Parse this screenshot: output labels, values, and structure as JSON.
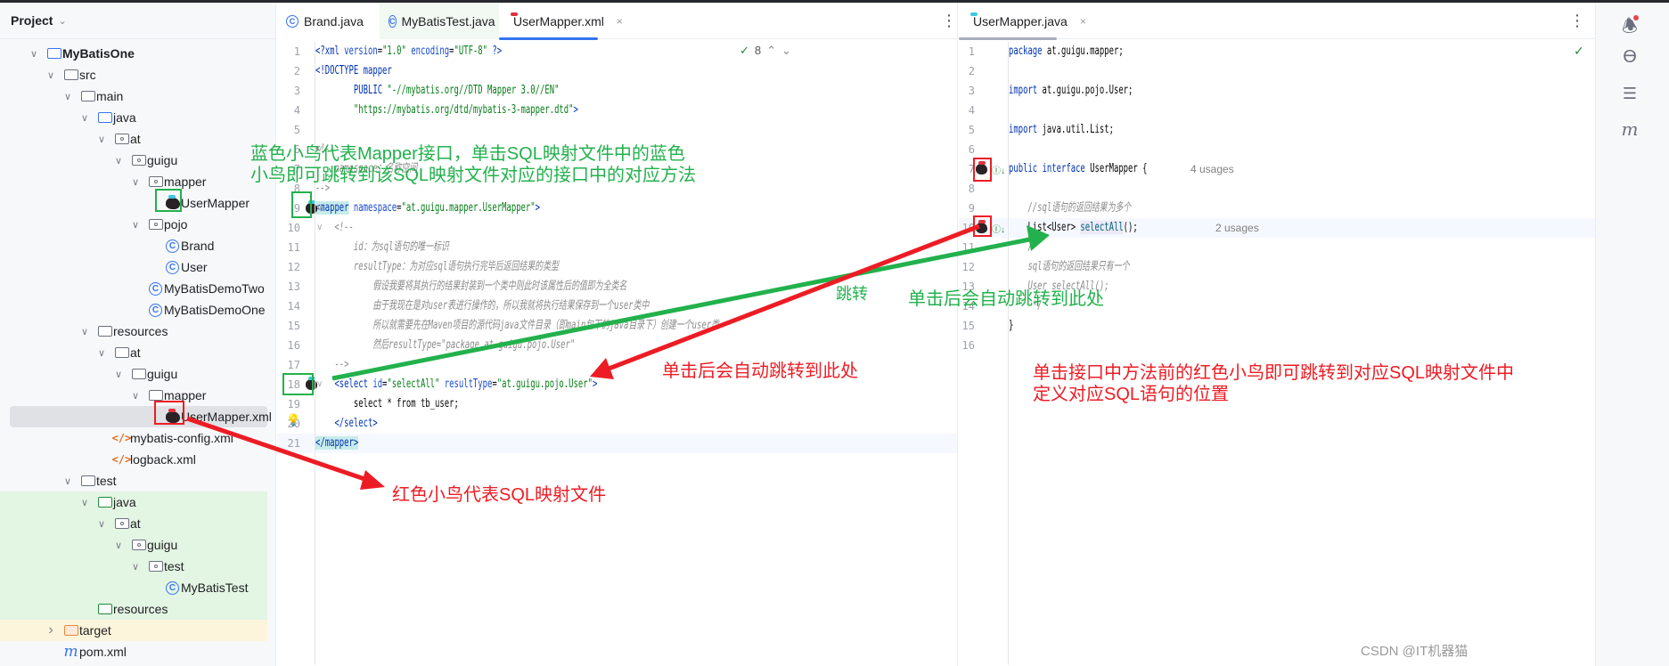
{
  "project_panel": {
    "title": "Project",
    "tree": [
      {
        "label": "MyBatisOne",
        "depth": 0,
        "icon": "module-folder",
        "expanded": true,
        "bold": true
      },
      {
        "label": "src",
        "depth": 1,
        "icon": "folder",
        "expanded": true
      },
      {
        "label": "main",
        "depth": 2,
        "icon": "folder",
        "expanded": true
      },
      {
        "label": "java",
        "depth": 3,
        "icon": "source-folder",
        "expanded": true
      },
      {
        "label": "at",
        "depth": 4,
        "icon": "package",
        "expanded": true
      },
      {
        "label": "guigu",
        "depth": 5,
        "icon": "package",
        "expanded": true
      },
      {
        "label": "mapper",
        "depth": 6,
        "icon": "package",
        "expanded": true
      },
      {
        "label": "UserMapper",
        "depth": 7,
        "icon": "mybatis-interface"
      },
      {
        "label": "pojo",
        "depth": 6,
        "icon": "package",
        "expanded": true
      },
      {
        "label": "Brand",
        "depth": 7,
        "icon": "class"
      },
      {
        "label": "User",
        "depth": 7,
        "icon": "class"
      },
      {
        "label": "MyBatisDemoTwo",
        "depth": 6,
        "icon": "runnable-class"
      },
      {
        "label": "MyBatisDemoOne",
        "depth": 6,
        "icon": "runnable-class"
      },
      {
        "label": "resources",
        "depth": 3,
        "icon": "resources-folder",
        "expanded": true
      },
      {
        "label": "at",
        "depth": 4,
        "icon": "folder",
        "expanded": true
      },
      {
        "label": "guigu",
        "depth": 5,
        "icon": "folder",
        "expanded": true
      },
      {
        "label": "mapper",
        "depth": 6,
        "icon": "folder",
        "expanded": true
      },
      {
        "label": "UserMapper.xml",
        "depth": 7,
        "icon": "mybatis-xml",
        "selected": true
      },
      {
        "label": "mybatis-config.xml",
        "depth": 4,
        "icon": "xml"
      },
      {
        "label": "logback.xml",
        "depth": 4,
        "icon": "xml"
      },
      {
        "label": "test",
        "depth": 2,
        "icon": "folder",
        "expanded": true
      },
      {
        "label": "java",
        "depth": 3,
        "icon": "test-source-folder",
        "expanded": true,
        "bg": "#e3f5e3"
      },
      {
        "label": "at",
        "depth": 4,
        "icon": "package",
        "expanded": true,
        "bg": "#e3f5e3"
      },
      {
        "label": "guigu",
        "depth": 5,
        "icon": "package",
        "expanded": true,
        "bg": "#e3f5e3"
      },
      {
        "label": "test",
        "depth": 6,
        "icon": "package",
        "expanded": true,
        "bg": "#e3f5e3"
      },
      {
        "label": "MyBatisTest",
        "depth": 7,
        "icon": "class",
        "bg": "#e3f5e3"
      },
      {
        "label": "resources",
        "depth": 3,
        "icon": "test-resources-folder",
        "bg": "#e3f5e3"
      },
      {
        "label": "target",
        "depth": 1,
        "icon": "excluded-folder",
        "expanded": false,
        "bg": "#fdf4dc"
      },
      {
        "label": "pom.xml",
        "depth": 1,
        "icon": "maven"
      }
    ]
  },
  "left_editor": {
    "tabs": [
      {
        "label": "Brand.java",
        "icon": "class-icon"
      },
      {
        "label": "MyBatisTest.java",
        "icon": "class-icon"
      },
      {
        "label": "UserMapper.xml",
        "icon": "mybatis-xml-icon",
        "active": true,
        "close": "×"
      }
    ],
    "inspection_count": "8",
    "lines": [
      [
        [
          "<?xml ",
          "tag"
        ],
        [
          "version",
          "attr"
        ],
        [
          "=",
          "plain"
        ],
        [
          "\"1.0\"",
          "str"
        ],
        [
          " ",
          "plain"
        ],
        [
          "encoding",
          "attr"
        ],
        [
          "=",
          "plain"
        ],
        [
          "\"UTF-8\"",
          "str"
        ],
        [
          " ?>",
          "tag"
        ]
      ],
      [
        [
          "<!DOCTYPE mapper",
          "tag"
        ]
      ],
      [
        [
          "        PUBLIC ",
          "tag"
        ],
        [
          "\"-//mybatis.org//DTD Mapper 3.0//EN\"",
          "str"
        ]
      ],
      [
        [
          "        ",
          "plain"
        ],
        [
          "\"https://mybatis.org/dtd/mybatis-3-mapper.dtd\"",
          "str"
        ],
        [
          ">",
          "tag"
        ]
      ],
      [],
      [
        [
          "<!--",
          "cmt"
        ]
      ],
      [
        [
          "    namespace：名称空间",
          "cmt"
        ]
      ],
      [
        [
          "-->",
          "cmt"
        ]
      ],
      [
        [
          "<mapper",
          "tag tagbg"
        ],
        [
          " namespace",
          "attr"
        ],
        [
          "=",
          "plain"
        ],
        [
          "\"at.guigu.mapper.UserMapper\"",
          "str"
        ],
        [
          ">",
          "tag"
        ]
      ],
      [
        [
          "    <!--",
          "cmt"
        ]
      ],
      [
        [
          "        id：为sql语句的唯一标识",
          "cmt"
        ]
      ],
      [
        [
          "        resultType：为对应sql语句执行完毕后返回结果的类型",
          "cmt"
        ]
      ],
      [
        [
          "            假设我要将其执行的结果封装到一个类中则此时该属性后的值即为全类名",
          "cmt"
        ]
      ],
      [
        [
          "            由于我现在是对user表进行操作的，所以我就将执行结果保存到一个user类中",
          "cmt"
        ]
      ],
      [
        [
          "            所以就需要先在Maven项目的源代码java文件目录（即main包下的java目录下）创建一个user类",
          "cmt"
        ]
      ],
      [
        [
          "            然后resultType=\"package at.guigu.pojo.User\"",
          "cmt"
        ]
      ],
      [
        [
          "    -->",
          "cmt"
        ]
      ],
      [
        [
          "    <select",
          "tag"
        ],
        [
          " id",
          "attr"
        ],
        [
          "=",
          "plain"
        ],
        [
          "\"selectAll\"",
          "str"
        ],
        [
          " resultType",
          "attr"
        ],
        [
          "=",
          "plain"
        ],
        [
          "\"at.guigu.pojo.User\"",
          "str"
        ],
        [
          ">",
          "tag"
        ]
      ],
      [
        [
          "        select * from tb_user;",
          "plain"
        ]
      ],
      [
        [
          "    </select>",
          "tag"
        ]
      ],
      [
        [
          "</mapper>",
          "tag tagbg"
        ]
      ]
    ]
  },
  "right_editor": {
    "tabs": [
      {
        "label": "UserMapper.java",
        "icon": "mybatis-interface-icon",
        "active": true,
        "close": "×"
      }
    ],
    "lines": [
      [
        [
          "package",
          "kw"
        ],
        [
          " at.guigu.mapper;",
          "plain"
        ]
      ],
      [],
      [
        [
          "import",
          "kw"
        ],
        [
          " at.guigu.pojo.User;",
          "plain"
        ]
      ],
      [],
      [
        [
          "import",
          "kw"
        ],
        [
          " java.util.List;",
          "plain"
        ]
      ],
      [],
      [
        [
          "public interface",
          "kw"
        ],
        [
          " UserMapper {",
          "plain"
        ]
      ],
      [],
      [
        [
          "    //sql语句的返回结果为多个",
          "cmt"
        ]
      ],
      [
        [
          "    List<User> ",
          "plain"
        ],
        [
          "selectAll",
          "meth"
        ],
        [
          "();",
          "plain"
        ]
      ],
      [
        [
          "    /*",
          "cmt"
        ]
      ],
      [
        [
          "    sql语句的返回结果只有一个",
          "cmt"
        ]
      ],
      [
        [
          "    User selectAll();",
          "cmt"
        ]
      ],
      [
        [
          "     */",
          "cmt"
        ]
      ],
      [
        [
          "}",
          "plain"
        ]
      ],
      []
    ],
    "inlays": {
      "line7": "4 usages",
      "line10": "2 usages"
    }
  },
  "annotations": {
    "green_note_1": "蓝色小鸟代表Mapper接口，单击SQL映射文件中的蓝色",
    "green_note_2": "小鸟即可跳转到该SQL映射文件对应的接口中的对应方法",
    "green_jump": "跳转",
    "green_arrival": "单击后会自动跳转到此处",
    "red_arrival": "单击后会自动跳转到此处",
    "red_xml_note": "红色小鸟代表SQL映射文件",
    "red_note_1": "单击接口中方法前的红色小鸟即可跳转到对应SQL映射文件中",
    "red_note_2": "定义对应SQL语句的位置",
    "colors": {
      "green": "#22b14c",
      "red": "#ed1c24"
    }
  },
  "right_toolbar": [
    "notifications-icon",
    "ai-assistant-icon",
    "database-icon",
    "maven-icon"
  ],
  "watermark": "CSDN @IT机器猫"
}
